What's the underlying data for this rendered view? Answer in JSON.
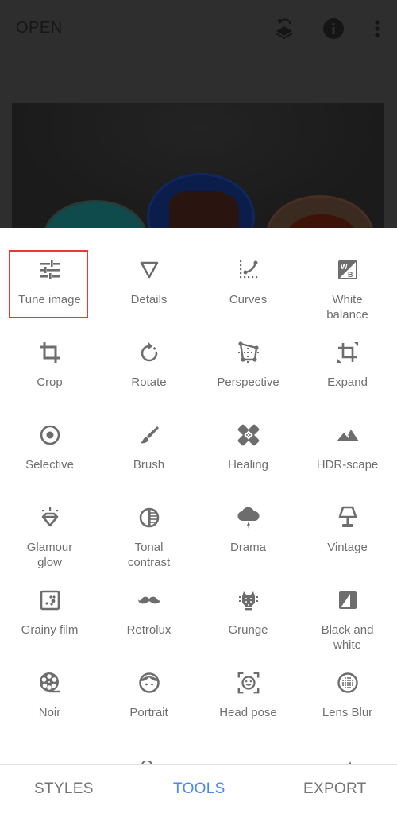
{
  "topbar": {
    "open_label": "OPEN",
    "icons": [
      "undo-layers-icon",
      "info-icon",
      "more-vert-icon"
    ]
  },
  "tools": [
    {
      "label": "Tune image",
      "icon": "tune-sliders-icon",
      "selected": true
    },
    {
      "label": "Details",
      "icon": "triangle-down-icon"
    },
    {
      "label": "Curves",
      "icon": "curves-icon"
    },
    {
      "label": "White balance",
      "icon": "white-balance-icon"
    },
    {
      "label": "Crop",
      "icon": "crop-icon"
    },
    {
      "label": "Rotate",
      "icon": "rotate-icon"
    },
    {
      "label": "Perspective",
      "icon": "perspective-icon"
    },
    {
      "label": "Expand",
      "icon": "expand-icon"
    },
    {
      "label": "Selective",
      "icon": "selective-icon"
    },
    {
      "label": "Brush",
      "icon": "brush-icon"
    },
    {
      "label": "Healing",
      "icon": "bandage-icon"
    },
    {
      "label": "HDR-scape",
      "icon": "mountain-icon"
    },
    {
      "label": "Glamour glow",
      "icon": "diamond-icon"
    },
    {
      "label": "Tonal contrast",
      "icon": "tonal-contrast-icon"
    },
    {
      "label": "Drama",
      "icon": "storm-cloud-icon"
    },
    {
      "label": "Vintage",
      "icon": "lamp-icon"
    },
    {
      "label": "Grainy film",
      "icon": "grain-icon"
    },
    {
      "label": "Retrolux",
      "icon": "mustache-icon"
    },
    {
      "label": "Grunge",
      "icon": "guitar-head-icon"
    },
    {
      "label": "Black and white",
      "icon": "black-white-icon"
    },
    {
      "label": "Noir",
      "icon": "film-reel-icon"
    },
    {
      "label": "Portrait",
      "icon": "face-icon"
    },
    {
      "label": "Head pose",
      "icon": "face-frame-icon"
    },
    {
      "label": "Lens Blur",
      "icon": "lens-blur-icon"
    }
  ],
  "bottom_nav": {
    "tabs": [
      {
        "label": "STYLES",
        "active": false
      },
      {
        "label": "TOOLS",
        "active": true
      },
      {
        "label": "EXPORT",
        "active": false
      }
    ]
  },
  "colors": {
    "accent": "#4a8af0",
    "selection_border": "#e53935",
    "icon": "#6d6d6d",
    "label": "#707070"
  }
}
